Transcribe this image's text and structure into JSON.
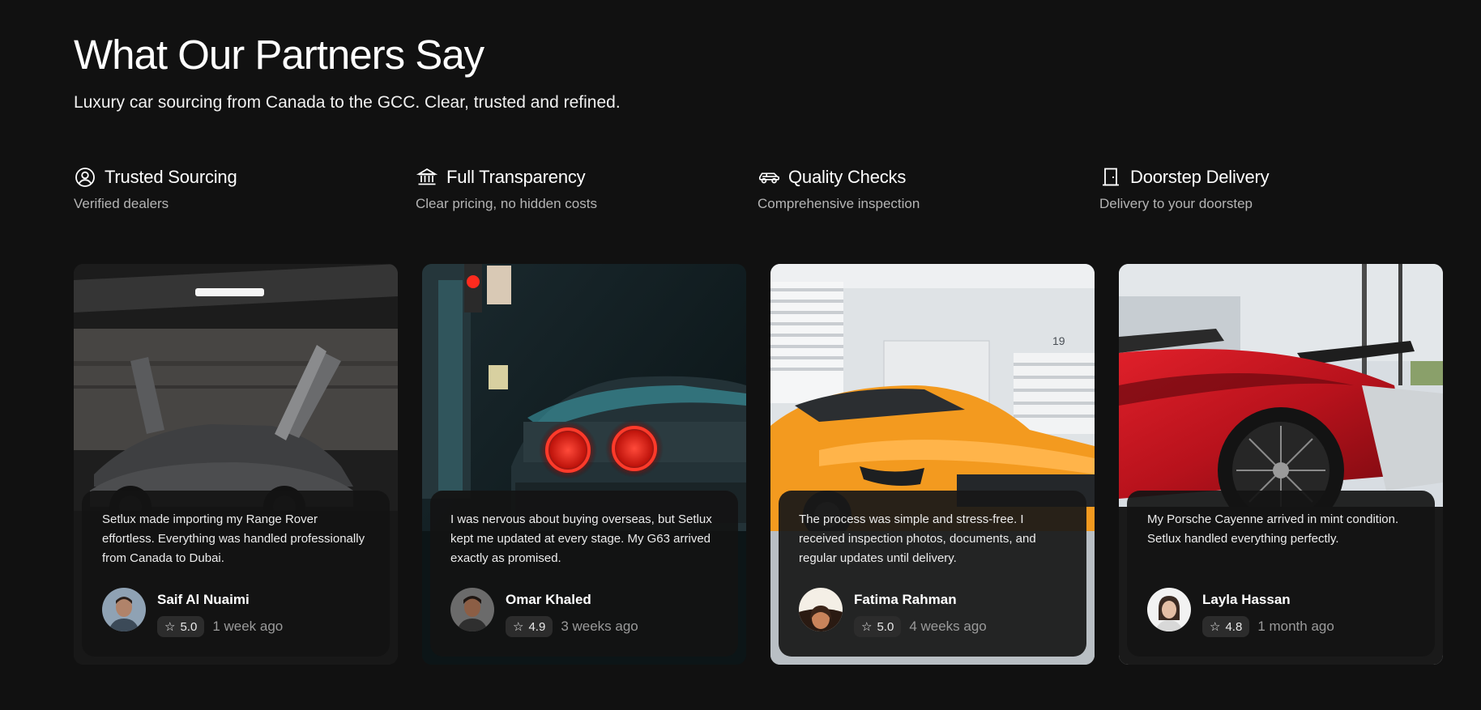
{
  "section": {
    "title": "What Our Partners Say",
    "subtitle": "Luxury car sourcing from Canada to the GCC. Clear, trusted and refined."
  },
  "features": [
    {
      "icon": "user-circle-icon",
      "title": "Trusted Sourcing",
      "description": "Verified dealers"
    },
    {
      "icon": "bank-icon",
      "title": "Full Transparency",
      "description": "Clear pricing, no hidden costs"
    },
    {
      "icon": "car-icon",
      "title": "Quality Checks",
      "description": "Comprehensive inspection"
    },
    {
      "icon": "door-icon",
      "title": "Doorstep Delivery",
      "description": "Delivery to your doorstep"
    }
  ],
  "testimonials": [
    {
      "quote": "Setlux made importing my Range Rover effortless. Everything was handled professionally from Canada to Dubai.",
      "name": "Saif Al Nuaimi",
      "rating": "5.0",
      "time": "1 week ago"
    },
    {
      "quote": "I was nervous about buying overseas, but Setlux kept me updated at every stage. My G63 arrived exactly as promised.",
      "name": "Omar Khaled",
      "rating": "4.9",
      "time": "3 weeks ago"
    },
    {
      "quote": "The process was simple and stress-free. I received inspection photos, documents, and regular updates until delivery.",
      "name": "Fatima Rahman",
      "rating": "5.0",
      "time": "4 weeks ago"
    },
    {
      "quote": "My Porsche Cayenne arrived in mint condition. Setlux handled everything perfectly.",
      "name": "Layla Hassan",
      "rating": "4.8",
      "time": "1 month ago"
    }
  ],
  "photo_labels": {
    "garage_number": "19"
  },
  "colors": {
    "background": "#111111",
    "card_overlay": "#141414",
    "rating_badge": "#2c2c2c"
  }
}
